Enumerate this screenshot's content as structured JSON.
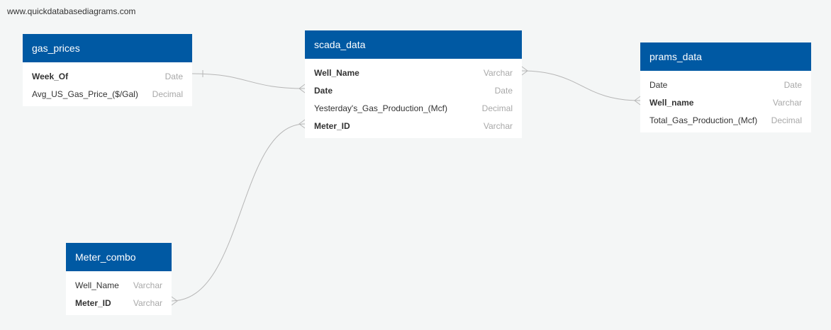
{
  "watermark": "www.quickdatabasediagrams.com",
  "tables": {
    "gas_prices": {
      "title": "gas_prices",
      "columns": [
        {
          "name": "Week_Of",
          "type": "Date",
          "key": true
        },
        {
          "name": "Avg_US_Gas_Price_($/Gal)",
          "type": "Decimal",
          "key": false
        }
      ]
    },
    "scada_data": {
      "title": "scada_data",
      "columns": [
        {
          "name": "Well_Name",
          "type": "Varchar",
          "key": true
        },
        {
          "name": "Date",
          "type": "Date",
          "key": true
        },
        {
          "name": "Yesterday's_Gas_Production_(Mcf)",
          "type": "Decimal",
          "key": false
        },
        {
          "name": "Meter_ID",
          "type": "Varchar",
          "key": true
        }
      ]
    },
    "prams_data": {
      "title": "prams_data",
      "columns": [
        {
          "name": "Date",
          "type": "Date",
          "key": false
        },
        {
          "name": "Well_name",
          "type": "Varchar",
          "key": true
        },
        {
          "name": "Total_Gas_Production_(Mcf)",
          "type": "Decimal",
          "key": false
        }
      ]
    },
    "meter_combo": {
      "title": "Meter_combo",
      "columns": [
        {
          "name": "Well_Name",
          "type": "Varchar",
          "key": false
        },
        {
          "name": "Meter_ID",
          "type": "Varchar",
          "key": true
        }
      ]
    }
  },
  "relationships": [
    {
      "from": "gas_prices.Week_Of",
      "to": "scada_data.Date"
    },
    {
      "from": "scada_data.Well_Name",
      "to": "prams_data.Well_name"
    },
    {
      "from": "Meter_combo.Meter_ID",
      "to": "scada_data.Meter_ID"
    }
  ]
}
